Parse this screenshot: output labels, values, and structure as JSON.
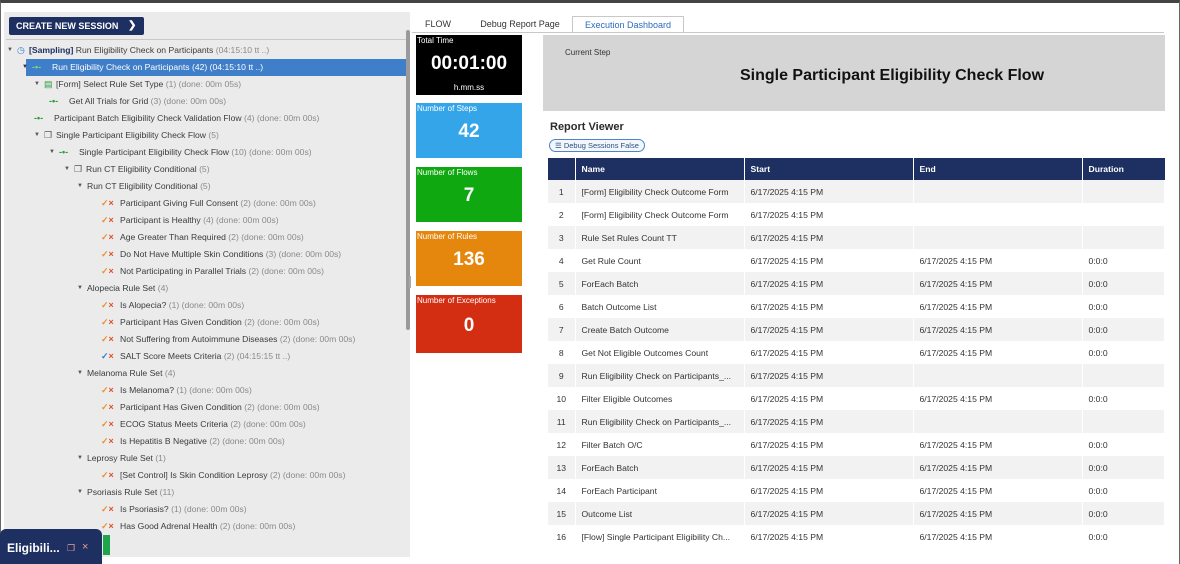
{
  "left_panel": {
    "create_button": "CREATE NEW SESSION",
    "tree": [
      {
        "indent": 0,
        "toggle": "▼",
        "icon": "clock",
        "label": "[Sampling]",
        "label2": " Run Eligibility Check on Participants",
        "meta": "(04:15:10 tt ..)",
        "bold": true
      },
      {
        "indent": 1,
        "toggle": "▼",
        "icon": "flow",
        "label": "Run Eligibility Check on Participants",
        "meta": "(42) (04:15:10 tt ..)",
        "selected": true
      },
      {
        "indent": 2,
        "toggle": "▼",
        "icon": "form",
        "label": "[Form] Select Rule Set Type",
        "meta": "(1) (done: 00m 05s)"
      },
      {
        "indent": 3,
        "toggle": "",
        "icon": "flow",
        "label": "Get All Trials for Grid",
        "meta": "(3) (done: 00m 00s)"
      },
      {
        "indent": 2,
        "toggle": "",
        "icon": "flow",
        "label": "Participant Batch Eligibility Check Validation Flow",
        "meta": "(4) (done: 00m 00s)"
      },
      {
        "indent": 2,
        "toggle": "▼",
        "icon": "sub",
        "label": "Single Participant Eligibility Check Flow",
        "meta": "(5)"
      },
      {
        "indent": 3,
        "toggle": "▼",
        "icon": "flow",
        "label": "Single Participant Eligibility Check Flow",
        "meta": "(10) (done: 00m 00s)"
      },
      {
        "indent": 4,
        "toggle": "▼",
        "icon": "sub",
        "label": "Run CT Eligibility Conditional",
        "meta": "(5)"
      },
      {
        "indent": 5,
        "toggle": "▼",
        "icon": "",
        "label": "Run CT Eligibility Conditional",
        "meta": "(5)"
      },
      {
        "indent": 6,
        "toggle": "",
        "icon": "chk",
        "label": "Participant Giving Full Consent",
        "meta": "(2) (done: 00m 00s)"
      },
      {
        "indent": 6,
        "toggle": "",
        "icon": "chk",
        "label": "Participant is Healthy",
        "meta": "(4) (done: 00m 00s)"
      },
      {
        "indent": 6,
        "toggle": "",
        "icon": "chk",
        "label": "Age Greater Than Required",
        "meta": "(2) (done: 00m 00s)"
      },
      {
        "indent": 6,
        "toggle": "",
        "icon": "chk",
        "label": "Do Not Have Multiple Skin Conditions",
        "meta": "(3) (done: 00m 00s)"
      },
      {
        "indent": 6,
        "toggle": "",
        "icon": "chk",
        "label": "Not Participating in Parallel Trials",
        "meta": "(2) (done: 00m 00s)"
      },
      {
        "indent": 5,
        "toggle": "▼",
        "icon": "",
        "label": "Alopecia Rule Set",
        "meta": "(4)"
      },
      {
        "indent": 6,
        "toggle": "",
        "icon": "chk",
        "label": "Is Alopecia?",
        "meta": "(1) (done: 00m 00s)"
      },
      {
        "indent": 6,
        "toggle": "",
        "icon": "chk",
        "label": "Participant Has Given Condition",
        "meta": "(2) (done: 00m 00s)"
      },
      {
        "indent": 6,
        "toggle": "",
        "icon": "chk",
        "label": "Not Suffering from Autoimmune Diseases",
        "meta": "(2) (done: 00m 00s)"
      },
      {
        "indent": 6,
        "toggle": "",
        "icon": "chkblue",
        "label": "SALT Score Meets Criteria",
        "meta": "(2) (04:15:15 tt ..)"
      },
      {
        "indent": 5,
        "toggle": "▼",
        "icon": "",
        "label": "Melanoma Rule Set",
        "meta": "(4)"
      },
      {
        "indent": 6,
        "toggle": "",
        "icon": "chk",
        "label": "Is Melanoma?",
        "meta": "(1) (done: 00m 00s)"
      },
      {
        "indent": 6,
        "toggle": "",
        "icon": "chk",
        "label": "Participant Has Given Condition",
        "meta": "(2) (done: 00m 00s)"
      },
      {
        "indent": 6,
        "toggle": "",
        "icon": "chk",
        "label": "ECOG Status Meets Criteria",
        "meta": "(2) (done: 00m 00s)"
      },
      {
        "indent": 6,
        "toggle": "",
        "icon": "chk",
        "label": "Is Hepatitis B Negative",
        "meta": "(2) (done: 00m 00s)"
      },
      {
        "indent": 5,
        "toggle": "▼",
        "icon": "",
        "label": "Leprosy Rule Set",
        "meta": "(1)"
      },
      {
        "indent": 6,
        "toggle": "",
        "icon": "chk",
        "label": "[Set Control] Is Skin Condition Leprosy",
        "meta": "(2) (done: 00m 00s)"
      },
      {
        "indent": 5,
        "toggle": "▼",
        "icon": "",
        "label": "Psoriasis Rule Set",
        "meta": "(11)"
      },
      {
        "indent": 6,
        "toggle": "",
        "icon": "chk",
        "label": "Is Psoriasis?",
        "meta": "(1) (done: 00m 00s)"
      },
      {
        "indent": 6,
        "toggle": "",
        "icon": "chk",
        "label": "Has Good Adrenal Health",
        "meta": "(2) (done: 00m 00s)"
      }
    ]
  },
  "tabs": [
    "FLOW",
    "Debug Report Page",
    "Execution Dashboard"
  ],
  "active_tab": "Execution Dashboard",
  "stats": {
    "total_time_title": "Total Time",
    "total_time_value": "00:01:00",
    "total_time_format": "h.mm.ss",
    "steps_title": "Number of Steps",
    "steps_value": "42",
    "flows_title": "Number of Flows",
    "flows_value": "7",
    "rules_title": "Number of Rules",
    "rules_value": "136",
    "exceptions_title": "Number of Exceptions",
    "exceptions_value": "0"
  },
  "current_step": {
    "label": "Current Step",
    "value": "Single Participant Eligibility Check Flow"
  },
  "report": {
    "title": "Report Viewer",
    "debug_button": "Debug Sessions False",
    "columns": [
      "",
      "Name",
      "Start",
      "End",
      "Duration"
    ],
    "rows": [
      [
        "1",
        "[Form] Eligibility Check Outcome Form",
        "6/17/2025 4:15 PM",
        "",
        ""
      ],
      [
        "2",
        "[Form] Eligibility Check Outcome Form",
        "6/17/2025 4:15 PM",
        "",
        ""
      ],
      [
        "3",
        "Rule Set Rules Count TT",
        "6/17/2025 4:15 PM",
        "",
        ""
      ],
      [
        "4",
        "Get Rule Count",
        "6/17/2025 4:15 PM",
        "6/17/2025 4:15 PM",
        "0:0:0"
      ],
      [
        "5",
        "ForEach Batch",
        "6/17/2025 4:15 PM",
        "6/17/2025 4:15 PM",
        "0:0:0"
      ],
      [
        "6",
        "Batch Outcome List",
        "6/17/2025 4:15 PM",
        "6/17/2025 4:15 PM",
        "0:0:0"
      ],
      [
        "7",
        "Create Batch Outcome",
        "6/17/2025 4:15 PM",
        "6/17/2025 4:15 PM",
        "0:0:0"
      ],
      [
        "8",
        "Get Not Eligible Outcomes Count",
        "6/17/2025 4:15 PM",
        "6/17/2025 4:15 PM",
        "0:0:0"
      ],
      [
        "9",
        "Run Eligibility Check on Participants_...",
        "6/17/2025 4:15 PM",
        "",
        ""
      ],
      [
        "10",
        "Filter Eligible Outcomes",
        "6/17/2025 4:15 PM",
        "6/17/2025 4:15 PM",
        "0:0:0"
      ],
      [
        "11",
        "Run Eligibility Check on Participants_...",
        "6/17/2025 4:15 PM",
        "",
        ""
      ],
      [
        "12",
        "Filter Batch O/C",
        "6/17/2025 4:15 PM",
        "6/17/2025 4:15 PM",
        "0:0:0"
      ],
      [
        "13",
        "ForEach Batch",
        "6/17/2025 4:15 PM",
        "6/17/2025 4:15 PM",
        "0:0:0"
      ],
      [
        "14",
        "ForEach Participant",
        "6/17/2025 4:15 PM",
        "6/17/2025 4:15 PM",
        "0:0:0"
      ],
      [
        "15",
        "Outcome List",
        "6/17/2025 4:15 PM",
        "6/17/2025 4:15 PM",
        "0:0:0"
      ],
      [
        "16",
        "[Flow] Single Participant Eligibility Ch...",
        "6/17/2025 4:15 PM",
        "6/17/2025 4:15 PM",
        "0:0:0"
      ]
    ]
  },
  "bottom_chip": {
    "title": "Eligibili..."
  },
  "colors": {
    "navy": "#1d3061",
    "selection": "#3f7ec8",
    "steps": "#35a5ea",
    "flows": "#10a810",
    "rules": "#e5860d",
    "exceptions": "#d32d12"
  }
}
